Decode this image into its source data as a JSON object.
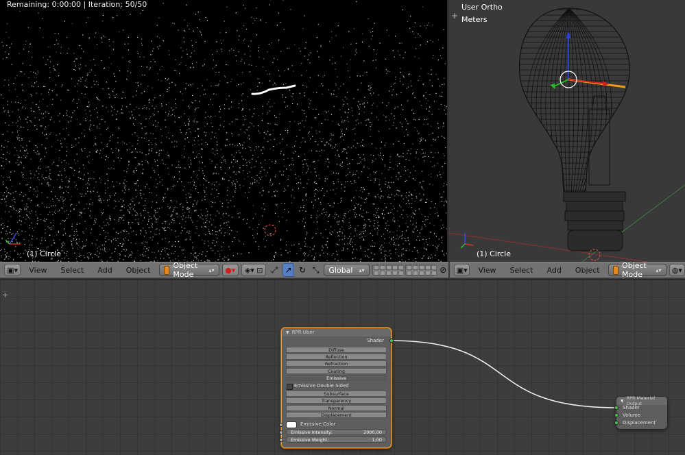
{
  "render_view": {
    "status": "Remaining: 0:00:00 | Iteration: 50/50",
    "object_label": "(1) Circle"
  },
  "ortho_view": {
    "view_name": "User Ortho",
    "units": "Meters",
    "object_label": "(1) Circle"
  },
  "left_header": {
    "menus": [
      "View",
      "Select",
      "Add",
      "Object"
    ],
    "mode": "Object Mode",
    "orientation": "Global"
  },
  "right_header": {
    "menus": [
      "View",
      "Select",
      "Add",
      "Object"
    ],
    "mode": "Object Mode"
  },
  "node_uber": {
    "title": "RPR Uber",
    "output_socket": "Shader",
    "layer_buttons": [
      "Diffuse",
      "Reflection",
      "Refraction",
      "Coating",
      "Emissive"
    ],
    "active_layer": "Emissive",
    "double_sided_label": "Emissive Double Sided",
    "extra_buttons": [
      "Subsurface",
      "Transparency",
      "Normal",
      "Displacement"
    ],
    "emissive_color_label": "Emissive Color",
    "emissive_intensity": {
      "label": "Emissive Intensity:",
      "value": "2000.00"
    },
    "emissive_weight": {
      "label": "Emissive Weight:",
      "value": "1.00"
    }
  },
  "node_output": {
    "title": "RPR Material Output",
    "inputs": [
      "Shader",
      "Volume",
      "Displacement"
    ]
  },
  "colors": {
    "selection_orange": "#e59a3c",
    "socket_green": "#47c84a",
    "viewport_bg": "#393939"
  }
}
